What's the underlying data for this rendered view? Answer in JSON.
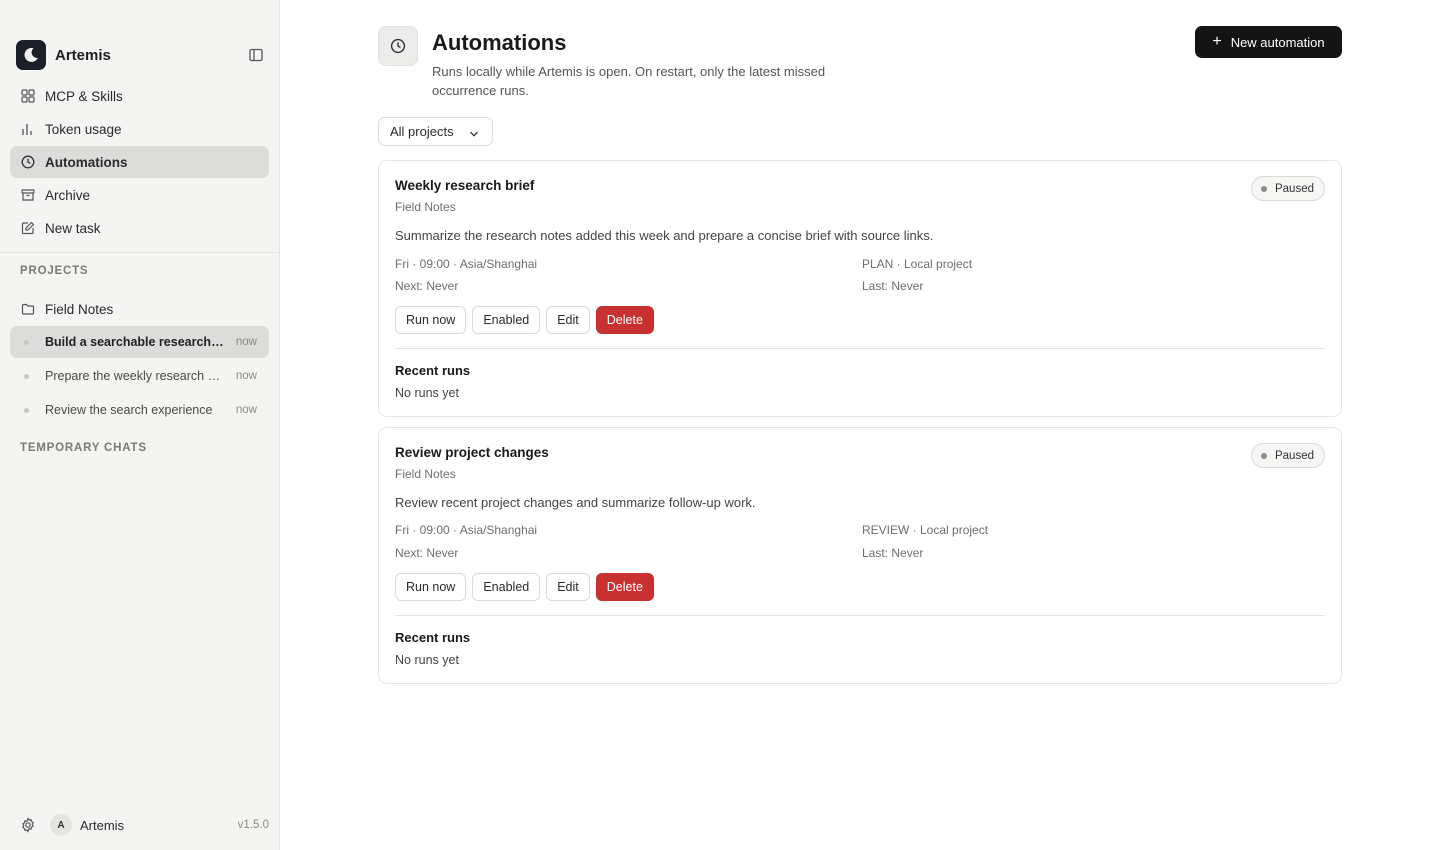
{
  "app": {
    "name": "Artemis",
    "version": "v1.5.0"
  },
  "sidebar": {
    "nav": [
      {
        "label": "MCP & Skills",
        "icon": "grid-icon"
      },
      {
        "label": "Token usage",
        "icon": "bar-chart-icon"
      },
      {
        "label": "Automations",
        "icon": "clock-icon",
        "active": true
      },
      {
        "label": "Archive",
        "icon": "archive-icon"
      },
      {
        "label": "New task",
        "icon": "edit-icon"
      }
    ],
    "projects_label": "PROJECTS",
    "project": {
      "name": "Field Notes",
      "icon": "folder-icon"
    },
    "tasks": [
      {
        "title": "Build a searchable research library",
        "time": "now",
        "active": true
      },
      {
        "title": "Prepare the weekly research brief",
        "time": "now"
      },
      {
        "title": "Review the search experience",
        "time": "now"
      }
    ],
    "temp_label": "TEMPORARY CHATS",
    "footer": {
      "avatar_initial": "A",
      "user": "Artemis"
    }
  },
  "page": {
    "title": "Automations",
    "description": "Runs locally while Artemis is open. On restart, only the latest missed occurrence runs.",
    "new_button": "New automation",
    "filter": "All projects"
  },
  "automations": [
    {
      "title": "Weekly research brief",
      "project": "Field Notes",
      "status": "Paused",
      "prompt": "Summarize the research notes added this week and prepare a concise brief with source links.",
      "schedule": "Fri · 09:00 · Asia/Shanghai",
      "mode": "PLAN · Local project",
      "next": "Next: Never",
      "last": "Last: Never",
      "actions": {
        "run": "Run now",
        "toggle": "Enabled",
        "edit": "Edit",
        "delete": "Delete"
      },
      "recent_runs_title": "Recent runs",
      "recent_runs_empty": "No runs yet"
    },
    {
      "title": "Review project changes",
      "project": "Field Notes",
      "status": "Paused",
      "prompt": "Review recent project changes and summarize follow-up work.",
      "schedule": "Fri · 09:00 · Asia/Shanghai",
      "mode": "REVIEW · Local project",
      "next": "Next: Never",
      "last": "Last: Never",
      "actions": {
        "run": "Run now",
        "toggle": "Enabled",
        "edit": "Edit",
        "delete": "Delete"
      },
      "recent_runs_title": "Recent runs",
      "recent_runs_empty": "No runs yet"
    }
  ],
  "colors": {
    "accent": "#141414",
    "danger": "#c93030",
    "sidebar_bg": "#f4f4f2"
  }
}
